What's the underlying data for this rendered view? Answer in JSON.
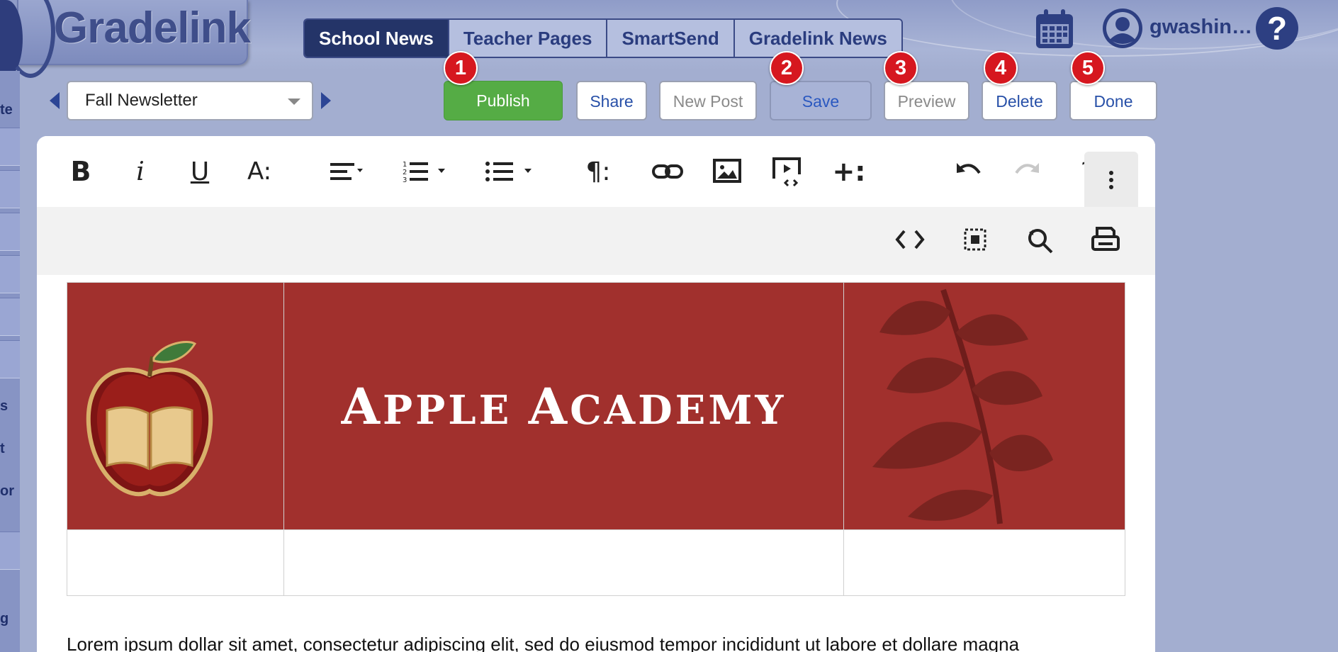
{
  "app": {
    "logo_text": "Gradelink"
  },
  "nav": {
    "tabs": [
      {
        "label": "School News",
        "active": true
      },
      {
        "label": "Teacher Pages",
        "active": false
      },
      {
        "label": "SmartSend",
        "active": false
      },
      {
        "label": "Gradelink News",
        "active": false
      }
    ]
  },
  "header": {
    "user_name": "gwashin…",
    "help_glyph": "?",
    "icons": [
      "calendar-icon",
      "user-avatar-icon",
      "help-icon"
    ]
  },
  "sidebar": {
    "partial_labels": [
      "te",
      "s",
      "t",
      "or",
      "g"
    ]
  },
  "toolbar": {
    "document_select": {
      "value": "Fall Newsletter"
    },
    "buttons": {
      "publish": "Publish",
      "share": "Share",
      "new_post": "New Post",
      "save": "Save",
      "preview": "Preview",
      "delete": "Delete",
      "done": "Done"
    },
    "markers": [
      "1",
      "2",
      "3",
      "4",
      "5"
    ]
  },
  "editor": {
    "toolbar_row1": [
      "bold",
      "italic",
      "underline",
      "font-size",
      "align",
      "ordered-list",
      "unordered-list",
      "paragraph-format",
      "link",
      "image",
      "video",
      "insert-more",
      "undo",
      "redo",
      "help",
      "more"
    ],
    "toolbar_row2": [
      "code-view",
      "select-all",
      "find-replace",
      "print"
    ],
    "glyphs": {
      "bold": "B",
      "italic": "i",
      "underline": "U",
      "font_size": "A:",
      "help": "?"
    },
    "banner": {
      "title_first_big": "A",
      "title_first_rest": "PPLE ",
      "title_second_big": "A",
      "title_second_rest": "CADEMY"
    },
    "body_text": "Lorem ipsum dollar sit amet, consectetur adipiscing elit, sed do eiusmod tempor incididunt ut labore et dollare magna"
  },
  "colors": {
    "header_bg": "#a3aed0",
    "nav_active": "#243468",
    "publish_green": "#55ac45",
    "marker_red": "#d6171f",
    "banner_red": "#a1302d",
    "link_blue": "#2850a8"
  }
}
